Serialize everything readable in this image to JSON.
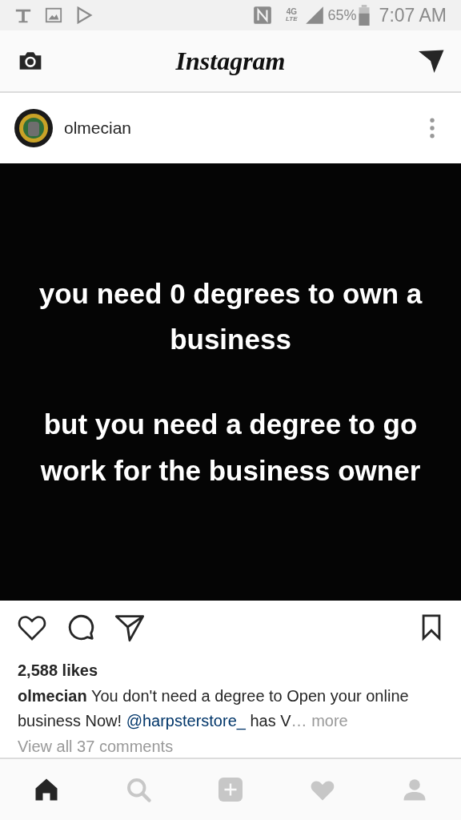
{
  "status_bar": {
    "network": "4G",
    "network_sub": "LTE",
    "battery": "65%",
    "time": "7:07 AM"
  },
  "header": {
    "logo": "Instagram"
  },
  "post": {
    "user": "olmecian",
    "image_text": [
      "you need 0 degrees to own a business",
      "but you need a degree to go work for the business owner"
    ],
    "liked": false,
    "saved": false,
    "likes": "2,588 likes",
    "caption": {
      "user": "olmecian",
      "text": " You don't need a degree to Open your online business Now! ",
      "mention": "@harpsterstore_",
      "text_after": " has V",
      "more": "… more"
    },
    "comments_link": "View all 37 comments"
  },
  "nav": [
    {
      "kind": "home",
      "selected": true
    },
    {
      "kind": "search",
      "selected": false
    },
    {
      "kind": "add",
      "selected": false
    },
    {
      "kind": "activity",
      "selected": false
    },
    {
      "kind": "profile",
      "selected": false
    }
  ]
}
